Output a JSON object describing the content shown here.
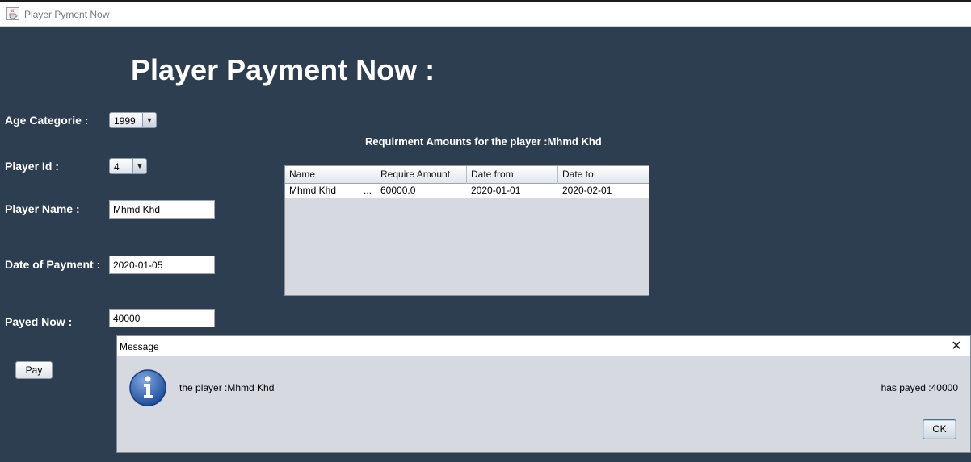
{
  "window": {
    "title": "Player Pyment Now",
    "icon": "java-cup-icon"
  },
  "page": {
    "heading": "Player Payment Now :"
  },
  "form": {
    "age_category": {
      "label": "Age Categorie :",
      "value": "1999"
    },
    "player_id": {
      "label": "Player Id :",
      "value": "4"
    },
    "player_name": {
      "label": "Player Name :",
      "value": "Mhmd Khd"
    },
    "date_of_payment": {
      "label": "Date of Payment :",
      "value": "2020-01-05"
    },
    "payed_now": {
      "label": "Payed Now :",
      "value": "40000"
    },
    "pay_button": "Pay"
  },
  "requirements": {
    "title": "Requirment Amounts for the player :Mhmd Khd",
    "columns": [
      "Name",
      "Require Amount",
      "Date from",
      "Date to"
    ],
    "rows": [
      [
        "Mhmd Khd",
        "...",
        "60000.0",
        "2020-01-01",
        "2020-02-01"
      ]
    ]
  },
  "dialog": {
    "title": "Message",
    "message_left": "the player :Mhmd Khd",
    "message_right": "has payed :40000",
    "ok_label": "OK",
    "icon": "information-icon"
  },
  "colors": {
    "background": "#2d3e50",
    "dialog_background": "#d6d9e0"
  }
}
